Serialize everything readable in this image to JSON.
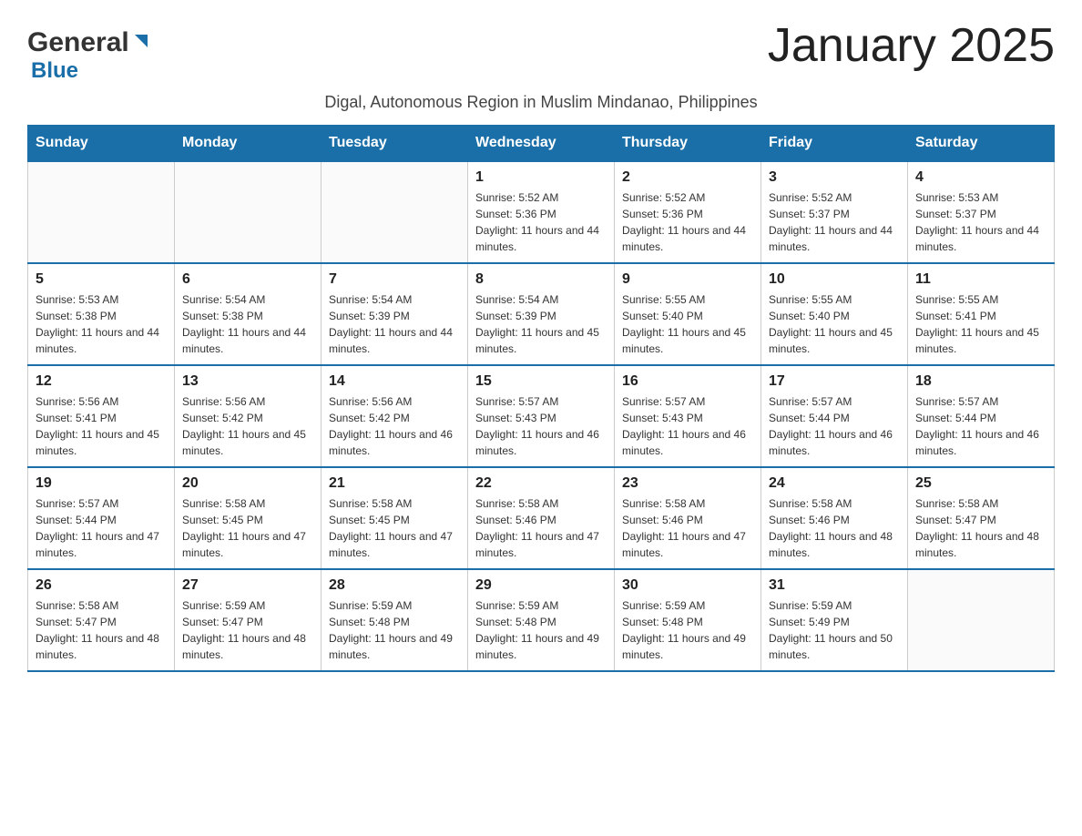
{
  "header": {
    "logo_general": "General",
    "logo_blue": "Blue",
    "month_title": "January 2025",
    "subtitle": "Digal, Autonomous Region in Muslim Mindanao, Philippines"
  },
  "days_of_week": [
    "Sunday",
    "Monday",
    "Tuesday",
    "Wednesday",
    "Thursday",
    "Friday",
    "Saturday"
  ],
  "weeks": [
    [
      {
        "day": "",
        "sunrise": "",
        "sunset": "",
        "daylight": ""
      },
      {
        "day": "",
        "sunrise": "",
        "sunset": "",
        "daylight": ""
      },
      {
        "day": "",
        "sunrise": "",
        "sunset": "",
        "daylight": ""
      },
      {
        "day": "1",
        "sunrise": "Sunrise: 5:52 AM",
        "sunset": "Sunset: 5:36 PM",
        "daylight": "Daylight: 11 hours and 44 minutes."
      },
      {
        "day": "2",
        "sunrise": "Sunrise: 5:52 AM",
        "sunset": "Sunset: 5:36 PM",
        "daylight": "Daylight: 11 hours and 44 minutes."
      },
      {
        "day": "3",
        "sunrise": "Sunrise: 5:52 AM",
        "sunset": "Sunset: 5:37 PM",
        "daylight": "Daylight: 11 hours and 44 minutes."
      },
      {
        "day": "4",
        "sunrise": "Sunrise: 5:53 AM",
        "sunset": "Sunset: 5:37 PM",
        "daylight": "Daylight: 11 hours and 44 minutes."
      }
    ],
    [
      {
        "day": "5",
        "sunrise": "Sunrise: 5:53 AM",
        "sunset": "Sunset: 5:38 PM",
        "daylight": "Daylight: 11 hours and 44 minutes."
      },
      {
        "day": "6",
        "sunrise": "Sunrise: 5:54 AM",
        "sunset": "Sunset: 5:38 PM",
        "daylight": "Daylight: 11 hours and 44 minutes."
      },
      {
        "day": "7",
        "sunrise": "Sunrise: 5:54 AM",
        "sunset": "Sunset: 5:39 PM",
        "daylight": "Daylight: 11 hours and 44 minutes."
      },
      {
        "day": "8",
        "sunrise": "Sunrise: 5:54 AM",
        "sunset": "Sunset: 5:39 PM",
        "daylight": "Daylight: 11 hours and 45 minutes."
      },
      {
        "day": "9",
        "sunrise": "Sunrise: 5:55 AM",
        "sunset": "Sunset: 5:40 PM",
        "daylight": "Daylight: 11 hours and 45 minutes."
      },
      {
        "day": "10",
        "sunrise": "Sunrise: 5:55 AM",
        "sunset": "Sunset: 5:40 PM",
        "daylight": "Daylight: 11 hours and 45 minutes."
      },
      {
        "day": "11",
        "sunrise": "Sunrise: 5:55 AM",
        "sunset": "Sunset: 5:41 PM",
        "daylight": "Daylight: 11 hours and 45 minutes."
      }
    ],
    [
      {
        "day": "12",
        "sunrise": "Sunrise: 5:56 AM",
        "sunset": "Sunset: 5:41 PM",
        "daylight": "Daylight: 11 hours and 45 minutes."
      },
      {
        "day": "13",
        "sunrise": "Sunrise: 5:56 AM",
        "sunset": "Sunset: 5:42 PM",
        "daylight": "Daylight: 11 hours and 45 minutes."
      },
      {
        "day": "14",
        "sunrise": "Sunrise: 5:56 AM",
        "sunset": "Sunset: 5:42 PM",
        "daylight": "Daylight: 11 hours and 46 minutes."
      },
      {
        "day": "15",
        "sunrise": "Sunrise: 5:57 AM",
        "sunset": "Sunset: 5:43 PM",
        "daylight": "Daylight: 11 hours and 46 minutes."
      },
      {
        "day": "16",
        "sunrise": "Sunrise: 5:57 AM",
        "sunset": "Sunset: 5:43 PM",
        "daylight": "Daylight: 11 hours and 46 minutes."
      },
      {
        "day": "17",
        "sunrise": "Sunrise: 5:57 AM",
        "sunset": "Sunset: 5:44 PM",
        "daylight": "Daylight: 11 hours and 46 minutes."
      },
      {
        "day": "18",
        "sunrise": "Sunrise: 5:57 AM",
        "sunset": "Sunset: 5:44 PM",
        "daylight": "Daylight: 11 hours and 46 minutes."
      }
    ],
    [
      {
        "day": "19",
        "sunrise": "Sunrise: 5:57 AM",
        "sunset": "Sunset: 5:44 PM",
        "daylight": "Daylight: 11 hours and 47 minutes."
      },
      {
        "day": "20",
        "sunrise": "Sunrise: 5:58 AM",
        "sunset": "Sunset: 5:45 PM",
        "daylight": "Daylight: 11 hours and 47 minutes."
      },
      {
        "day": "21",
        "sunrise": "Sunrise: 5:58 AM",
        "sunset": "Sunset: 5:45 PM",
        "daylight": "Daylight: 11 hours and 47 minutes."
      },
      {
        "day": "22",
        "sunrise": "Sunrise: 5:58 AM",
        "sunset": "Sunset: 5:46 PM",
        "daylight": "Daylight: 11 hours and 47 minutes."
      },
      {
        "day": "23",
        "sunrise": "Sunrise: 5:58 AM",
        "sunset": "Sunset: 5:46 PM",
        "daylight": "Daylight: 11 hours and 47 minutes."
      },
      {
        "day": "24",
        "sunrise": "Sunrise: 5:58 AM",
        "sunset": "Sunset: 5:46 PM",
        "daylight": "Daylight: 11 hours and 48 minutes."
      },
      {
        "day": "25",
        "sunrise": "Sunrise: 5:58 AM",
        "sunset": "Sunset: 5:47 PM",
        "daylight": "Daylight: 11 hours and 48 minutes."
      }
    ],
    [
      {
        "day": "26",
        "sunrise": "Sunrise: 5:58 AM",
        "sunset": "Sunset: 5:47 PM",
        "daylight": "Daylight: 11 hours and 48 minutes."
      },
      {
        "day": "27",
        "sunrise": "Sunrise: 5:59 AM",
        "sunset": "Sunset: 5:47 PM",
        "daylight": "Daylight: 11 hours and 48 minutes."
      },
      {
        "day": "28",
        "sunrise": "Sunrise: 5:59 AM",
        "sunset": "Sunset: 5:48 PM",
        "daylight": "Daylight: 11 hours and 49 minutes."
      },
      {
        "day": "29",
        "sunrise": "Sunrise: 5:59 AM",
        "sunset": "Sunset: 5:48 PM",
        "daylight": "Daylight: 11 hours and 49 minutes."
      },
      {
        "day": "30",
        "sunrise": "Sunrise: 5:59 AM",
        "sunset": "Sunset: 5:48 PM",
        "daylight": "Daylight: 11 hours and 49 minutes."
      },
      {
        "day": "31",
        "sunrise": "Sunrise: 5:59 AM",
        "sunset": "Sunset: 5:49 PM",
        "daylight": "Daylight: 11 hours and 50 minutes."
      },
      {
        "day": "",
        "sunrise": "",
        "sunset": "",
        "daylight": ""
      }
    ]
  ]
}
